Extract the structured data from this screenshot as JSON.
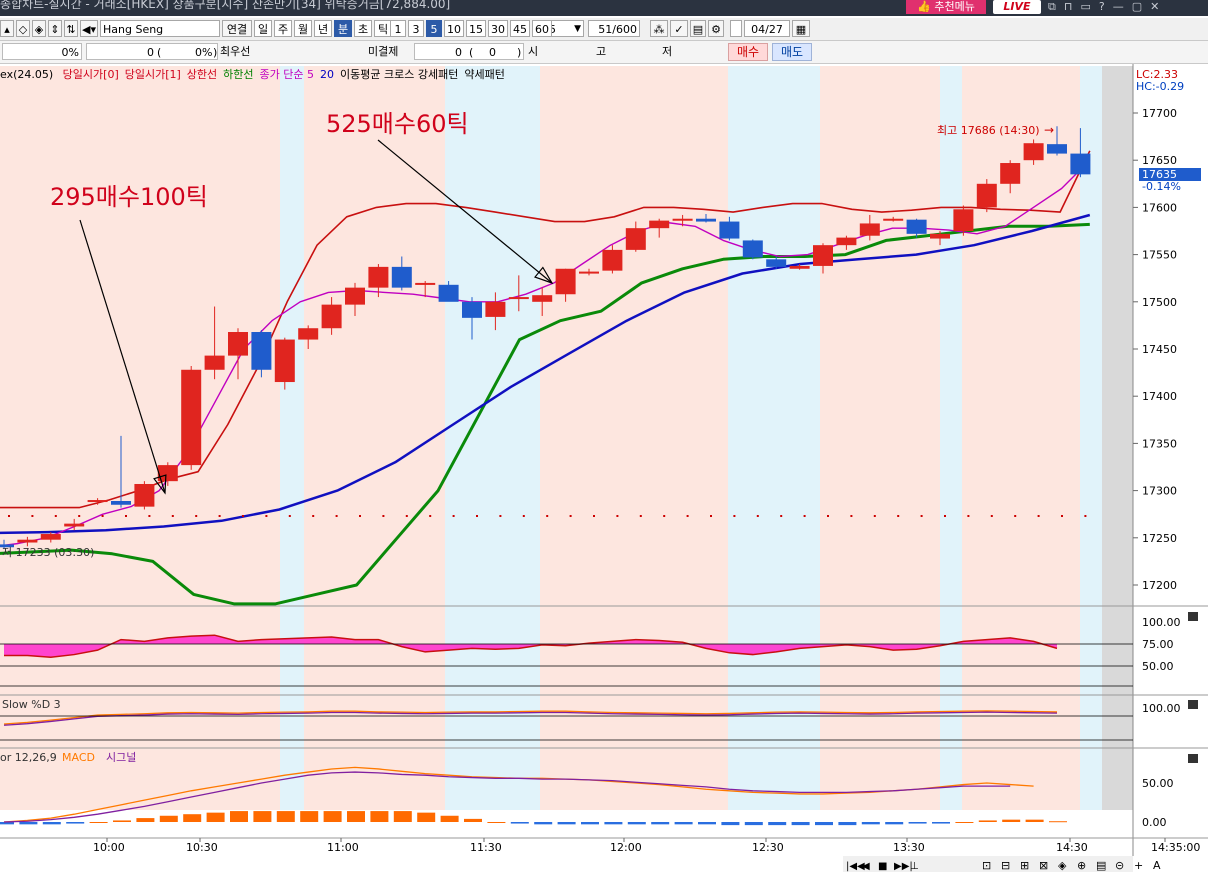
{
  "titlebar": {
    "text": "종합차트-실시간 - 거래소[HKEX] 상품구분[지수] 잔존만기[34] 위탁증거금[72,884.00]",
    "recommend_label": "추천메뉴",
    "live_label": "LIVE"
  },
  "toolbar": {
    "symbol": "Hang Seng Index(24.0",
    "view_label": "연결",
    "periods": [
      "일",
      "주",
      "월",
      "년",
      "분",
      "초",
      "틱"
    ],
    "selected_period": "분",
    "intervals": [
      "1",
      "3",
      "5",
      "10",
      "15",
      "30",
      "45",
      "60"
    ],
    "selected_interval": "5",
    "interval_value": "5",
    "count": "51",
    "count_total": "/600",
    "date": "04/27"
  },
  "row2": {
    "pct1": "0%",
    "qty": "0",
    "pct2": "0%",
    "best_label": "최우선",
    "unfilled_label": "미결제",
    "unfilled_value": "0",
    "unfilled_paren": "0",
    "market_label": "시",
    "high_label": "고",
    "low_label": "저",
    "buy_label": "매수",
    "sell_label": "매도"
  },
  "legend": {
    "prefix": "ex(24.05)",
    "items": [
      {
        "label": "당일시가[0]",
        "color": "#d0021b"
      },
      {
        "label": "당일시가[1]",
        "color": "#d0021b"
      },
      {
        "label": "상한선",
        "color": "#d0021b"
      },
      {
        "label": "하한선",
        "color": "#008000"
      },
      {
        "label": "종가 단순 5",
        "color": "#c000c0"
      },
      {
        "label": "20",
        "color": "#0000c0"
      },
      {
        "label": "이동평균 크로스 강세패턴",
        "color": "#000000"
      },
      {
        "label": "약세패턴",
        "color": "#000000"
      }
    ]
  },
  "annotations": {
    "a1": "295매수100틱",
    "a2": "525매수60틱",
    "high_marker": "최고 17686 (14:30)",
    "low_marker": "저 17233 (03:30)",
    "lc": "LC:2.33",
    "hc": "HC:-0.29",
    "last_price": "17635",
    "last_change": "-0.14%"
  },
  "panels": {
    "rsi_ticks": [
      "100.00",
      "75.00",
      "50.00"
    ],
    "stoch_label": "Slow %D 3",
    "stoch_tick": "100.00",
    "macd_label": "or 12,26,9",
    "macd_name": "MACD",
    "signal_name": "시그널",
    "macd_ticks": [
      "50.00",
      "0.00"
    ]
  },
  "colors": {
    "bull": "#e0251f",
    "bear": "#1f5ccc",
    "zone_pink": "#fde6df",
    "zone_blue": "#e1f3fa"
  },
  "chart_data": {
    "type": "candlestick",
    "ylim": [
      17180,
      17720
    ],
    "y_ticks": [
      17700,
      17650,
      17600,
      17550,
      17500,
      17450,
      17400,
      17350,
      17300,
      17250,
      17200
    ],
    "x_labels": [
      "10:00",
      "10:30",
      "11:00",
      "11:30",
      "12:00",
      "12:30",
      "13:30",
      "14:30",
      "14:35:00"
    ],
    "candles": [
      {
        "o": 17243,
        "h": 17248,
        "l": 17238,
        "c": 17240
      },
      {
        "o": 17245,
        "h": 17251,
        "l": 17241,
        "c": 17248
      },
      {
        "o": 17248,
        "h": 17256,
        "l": 17245,
        "c": 17254
      },
      {
        "o": 17262,
        "h": 17270,
        "l": 17258,
        "c": 17265
      },
      {
        "o": 17289,
        "h": 17292,
        "l": 17285,
        "c": 17290
      },
      {
        "o": 17289,
        "h": 17358,
        "l": 17282,
        "c": 17285
      },
      {
        "o": 17283,
        "h": 17310,
        "l": 17280,
        "c": 17307
      },
      {
        "o": 17310,
        "h": 17330,
        "l": 17305,
        "c": 17327
      },
      {
        "o": 17327,
        "h": 17432,
        "l": 17322,
        "c": 17428
      },
      {
        "o": 17428,
        "h": 17495,
        "l": 17418,
        "c": 17443
      },
      {
        "o": 17443,
        "h": 17472,
        "l": 17418,
        "c": 17468
      },
      {
        "o": 17468,
        "h": 17470,
        "l": 17420,
        "c": 17428
      },
      {
        "o": 17415,
        "h": 17462,
        "l": 17407,
        "c": 17460
      },
      {
        "o": 17460,
        "h": 17475,
        "l": 17450,
        "c": 17472
      },
      {
        "o": 17472,
        "h": 17505,
        "l": 17465,
        "c": 17497
      },
      {
        "o": 17497,
        "h": 17520,
        "l": 17485,
        "c": 17515
      },
      {
        "o": 17515,
        "h": 17540,
        "l": 17505,
        "c": 17537
      },
      {
        "o": 17537,
        "h": 17548,
        "l": 17512,
        "c": 17515
      },
      {
        "o": 17518,
        "h": 17522,
        "l": 17505,
        "c": 17520
      },
      {
        "o": 17518,
        "h": 17522,
        "l": 17502,
        "c": 17500
      },
      {
        "o": 17500,
        "h": 17505,
        "l": 17460,
        "c": 17483
      },
      {
        "o": 17484,
        "h": 17510,
        "l": 17470,
        "c": 17500
      },
      {
        "o": 17503,
        "h": 17528,
        "l": 17490,
        "c": 17505
      },
      {
        "o": 17500,
        "h": 17515,
        "l": 17485,
        "c": 17507
      },
      {
        "o": 17508,
        "h": 17535,
        "l": 17500,
        "c": 17535
      },
      {
        "o": 17530,
        "h": 17535,
        "l": 17528,
        "c": 17532
      },
      {
        "o": 17533,
        "h": 17560,
        "l": 17530,
        "c": 17555
      },
      {
        "o": 17555,
        "h": 17585,
        "l": 17553,
        "c": 17578
      },
      {
        "o": 17578,
        "h": 17588,
        "l": 17568,
        "c": 17586
      },
      {
        "o": 17586,
        "h": 17592,
        "l": 17580,
        "c": 17588
      },
      {
        "o": 17588,
        "h": 17593,
        "l": 17584,
        "c": 17585
      },
      {
        "o": 17585,
        "h": 17590,
        "l": 17565,
        "c": 17567
      },
      {
        "o": 17565,
        "h": 17566,
        "l": 17545,
        "c": 17547
      },
      {
        "o": 17545,
        "h": 17548,
        "l": 17535,
        "c": 17537
      },
      {
        "o": 17535,
        "h": 17540,
        "l": 17534,
        "c": 17538
      },
      {
        "o": 17538,
        "h": 17562,
        "l": 17530,
        "c": 17560
      },
      {
        "o": 17560,
        "h": 17570,
        "l": 17555,
        "c": 17568
      },
      {
        "o": 17570,
        "h": 17592,
        "l": 17565,
        "c": 17583
      },
      {
        "o": 17587,
        "h": 17590,
        "l": 17585,
        "c": 17588
      },
      {
        "o": 17587,
        "h": 17588,
        "l": 17568,
        "c": 17572
      },
      {
        "o": 17567,
        "h": 17575,
        "l": 17560,
        "c": 17572
      },
      {
        "o": 17575,
        "h": 17602,
        "l": 17570,
        "c": 17598
      },
      {
        "o": 17600,
        "h": 17630,
        "l": 17595,
        "c": 17625
      },
      {
        "o": 17625,
        "h": 17650,
        "l": 17615,
        "c": 17647
      },
      {
        "o": 17650,
        "h": 17672,
        "l": 17645,
        "c": 17668
      },
      {
        "o": 17667,
        "h": 17686,
        "l": 17655,
        "c": 17657
      },
      {
        "o": 17657,
        "h": 17684,
        "l": 17632,
        "c": 17635
      }
    ],
    "upper_band": [
      17282,
      17282,
      17282,
      17282,
      17290,
      17300,
      17312,
      17320,
      17370,
      17430,
      17500,
      17560,
      17590,
      17600,
      17604,
      17604,
      17600,
      17595,
      17590,
      17585,
      17585,
      17590,
      17600,
      17600,
      17598,
      17595,
      17600,
      17604,
      17604,
      17598,
      17595,
      17597,
      17600,
      17600,
      17598,
      17597,
      17595,
      17660
    ],
    "ma5": [
      17240,
      17244,
      17250,
      17262,
      17275,
      17283,
      17300,
      17340,
      17395,
      17450,
      17480,
      17500,
      17510,
      17512,
      17510,
      17508,
      17504,
      17500,
      17500,
      17508,
      17520,
      17540,
      17560,
      17575,
      17584,
      17580,
      17565,
      17555,
      17548,
      17550,
      17560,
      17570,
      17578,
      17578,
      17576,
      17572,
      17580,
      17600,
      17620,
      17650
    ],
    "ma20": [
      17255,
      17256,
      17258,
      17262,
      17268,
      17280,
      17300,
      17330,
      17370,
      17410,
      17445,
      17480,
      17510,
      17530,
      17540,
      17545,
      17550,
      17560,
      17575,
      17592
    ],
    "lower_band": [
      17233,
      17235,
      17237,
      17233,
      17225,
      17190,
      17180,
      17180,
      17190,
      17200,
      17250,
      17300,
      17380,
      17460,
      17480,
      17490,
      17520,
      17535,
      17545,
      17548,
      17548,
      17550,
      17565,
      17570,
      17575,
      17580,
      17580,
      17582
    ]
  }
}
